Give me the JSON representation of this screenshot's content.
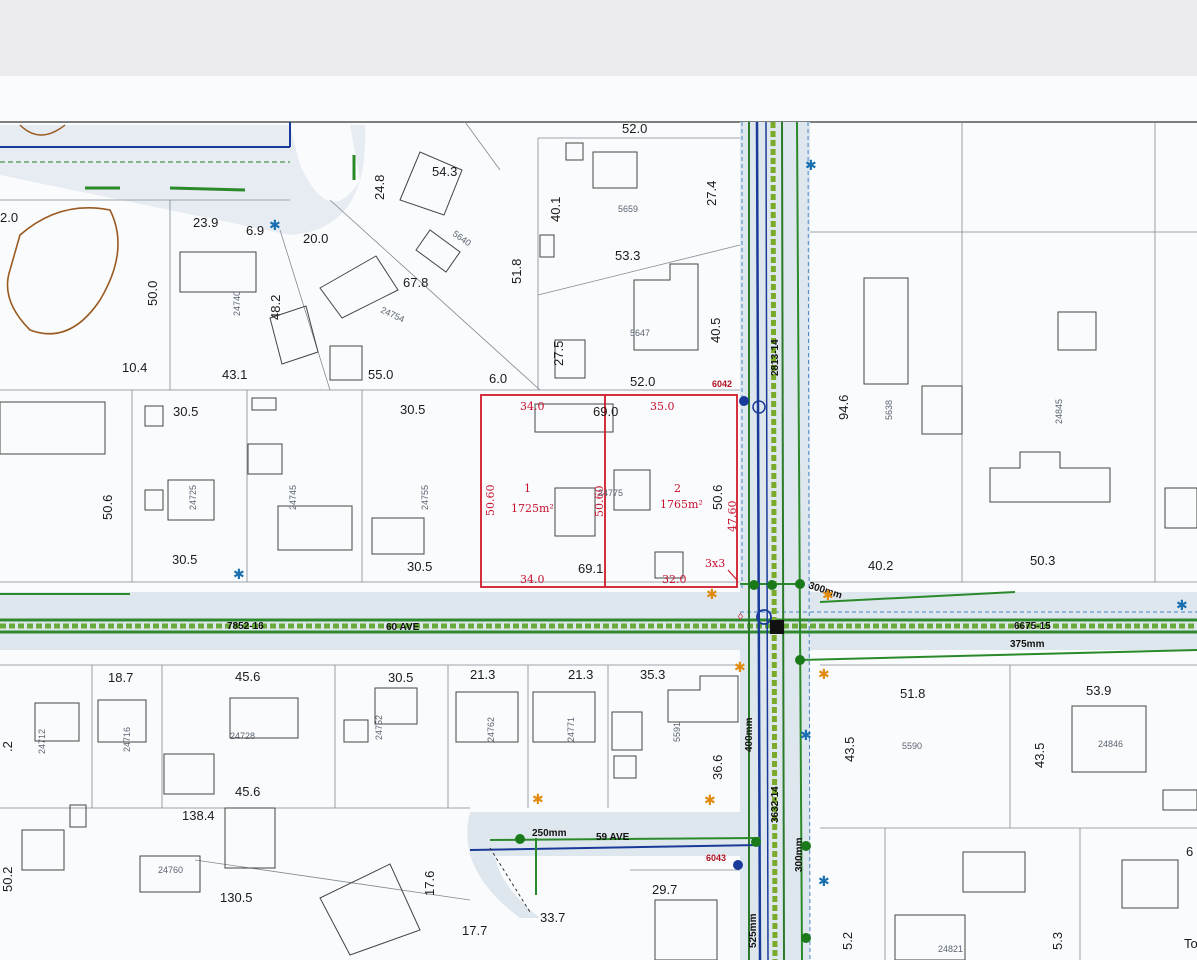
{
  "street": {
    "name": "60 AVE",
    "segment_west": "7852-16",
    "segment_east": "6675-15",
    "cross_north": "2813-14",
    "cross_south": "3632-14",
    "south_street": "59 AVE"
  },
  "pipes": {
    "p300_ne": "300mm",
    "p375": "375mm",
    "p400": "400mm",
    "p250": "250mm",
    "p300_s": "300mm",
    "p525": "525mm"
  },
  "nodes": {
    "n6042": "6042",
    "n6043": "6043"
  },
  "subject": {
    "lot1_label": "1",
    "lot1_area": "1725m²",
    "lot2_label": "2",
    "lot2_area": "1765m²",
    "top_left": "34.0",
    "top_right": "35.0",
    "bottom_left": "34.0",
    "bottom_right": "32.0",
    "left_side": "50.60",
    "mid_line": "50.60",
    "right_side": "47.60",
    "corner": "3x3"
  },
  "addresses": [
    "5659",
    "5640",
    "24740",
    "24754",
    "5647",
    "24725",
    "24745",
    "24755",
    "24775",
    "5638",
    "24845",
    "24712",
    "24716",
    "24728",
    "24752",
    "24762",
    "24771",
    "5591",
    "5590",
    "24846",
    "24760",
    "24821"
  ],
  "dims": [
    "52.0",
    "54.3",
    "24.8",
    "40.1",
    "27.4",
    "23.9",
    "6.9",
    "20.0",
    "51.8",
    "53.3",
    "50.0",
    "48.2",
    "67.8",
    "27.5",
    "40.5",
    "10.4",
    "43.1",
    "55.0",
    "6.0",
    "52.0",
    "94.6",
    "30.5",
    "30.5",
    "69.0",
    "50.6",
    "50.6",
    "30.5",
    "30.5",
    "69.1",
    "40.2",
    "50.3",
    "18.7",
    "45.6",
    "30.5",
    "21.3",
    "21.3",
    "35.3",
    "51.8",
    "53.9",
    "43.5",
    "43.5",
    "36.6",
    "45.6",
    "138.4",
    "17.6",
    "29.7",
    "130.5",
    "50.2",
    "17.7",
    "33.7",
    "2.0",
    ".2",
    "5.2",
    "5.3",
    "6"
  ],
  "corner_text": "To"
}
